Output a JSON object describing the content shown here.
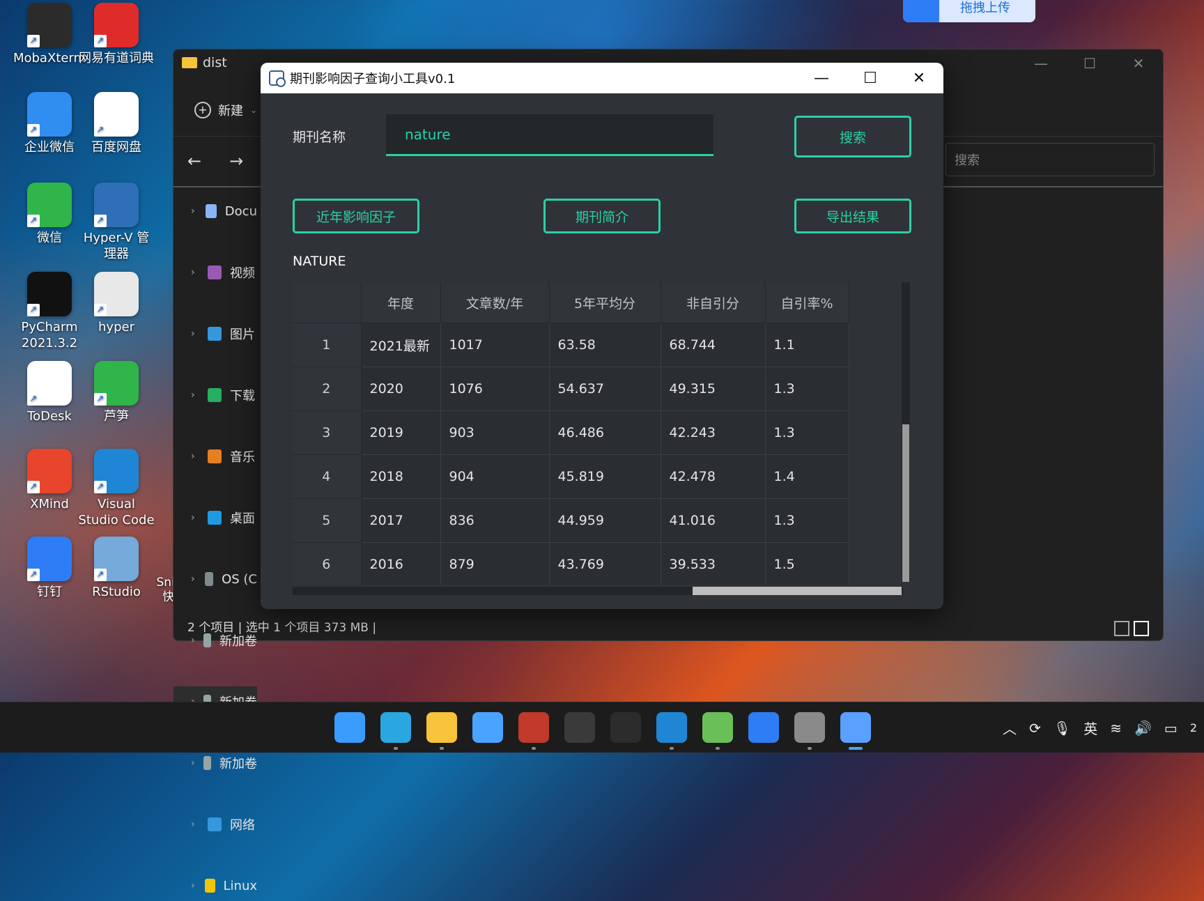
{
  "desktop": {
    "icons": [
      {
        "label": "MobaXterm",
        "color": "#2b2b2b"
      },
      {
        "label": "网易有道词典",
        "color": "#e02b2b"
      },
      {
        "label": "企业微信",
        "color": "#2f8ef0"
      },
      {
        "label": "百度网盘",
        "color": "#ffffff"
      },
      {
        "label": "微信",
        "color": "#2fb54a"
      },
      {
        "label": "Hyper-V 管理器",
        "color": "#2e6fb7"
      },
      {
        "label": "PyCharm 2021.3.2",
        "color": "#111111"
      },
      {
        "label": "hyper",
        "color": "#e8e8e8"
      },
      {
        "label": "ToDesk",
        "color": "#ffffff"
      },
      {
        "label": "芦笋",
        "color": "#2fb54a"
      },
      {
        "label": "XMind",
        "color": "#e8452c"
      },
      {
        "label": "Visual Studio Code",
        "color": "#1f86d6"
      },
      {
        "label": "钉钉",
        "color": "#2f7df6"
      },
      {
        "label": "RStudio",
        "color": "#75aadb"
      }
    ],
    "snipaste_label": "Snipaste - 快捷方式"
  },
  "upload_banner": {
    "label": "拖拽上传"
  },
  "explorer": {
    "title": "dist",
    "new_label": "新建",
    "search_placeholder": "搜索",
    "tree": [
      {
        "label": "Docu",
        "color": "#8ab4f8"
      },
      {
        "label": "视频",
        "color": "#9b59b6"
      },
      {
        "label": "图片",
        "color": "#3498db"
      },
      {
        "label": "下载",
        "color": "#27ae60"
      },
      {
        "label": "音乐",
        "color": "#e67e22"
      },
      {
        "label": "桌面",
        "color": "#1f9ae0"
      },
      {
        "label": "OS (C",
        "color": "#7f8c8d"
      },
      {
        "label": "新加卷",
        "color": "#95a5a6"
      },
      {
        "label": "新加卷",
        "color": "#95a5a6"
      },
      {
        "label": "新加卷",
        "color": "#95a5a6"
      },
      {
        "label": "网络",
        "color": "#3498db"
      },
      {
        "label": "Linux",
        "color": "#f1c40f"
      }
    ],
    "status": "2 个项目  |  选中 1 个项目  373 MB  |"
  },
  "app": {
    "title": "期刊影响因子查询小工具v0.1",
    "journal_label": "期刊名称",
    "search_value": "nature",
    "search_button": "搜索",
    "recent_if_button": "近年影响因子",
    "intro_button": "期刊简介",
    "export_button": "导出结果",
    "journal_name": "NATURE",
    "accent": "#2ad1a8",
    "table": {
      "headers": [
        "",
        "年度",
        "文章数/年",
        "5年平均分",
        "非自引分",
        "自引率%"
      ],
      "rows": [
        [
          "1",
          "2021最新",
          "1017",
          "63.58",
          "68.744",
          "1.1"
        ],
        [
          "2",
          "2020",
          "1076",
          "54.637",
          "49.315",
          "1.3"
        ],
        [
          "3",
          "2019",
          "903",
          "46.486",
          "42.243",
          "1.3"
        ],
        [
          "4",
          "2018",
          "904",
          "45.819",
          "42.478",
          "1.4"
        ],
        [
          "5",
          "2017",
          "836",
          "44.959",
          "41.016",
          "1.3"
        ],
        [
          "6",
          "2016",
          "879",
          "43.769",
          "39.533",
          "1.5"
        ]
      ]
    }
  },
  "taskbar": {
    "apps": [
      "start-icon",
      "edge-icon",
      "file-explorer-icon",
      "store-icon",
      "mcafee-icon",
      "terminal-icon",
      "cmd-icon",
      "vscode-icon",
      "notepad-icon",
      "dingtalk-icon",
      "settings-icon",
      "journal-tool-icon"
    ],
    "ime": "英",
    "clock_fragment": "2"
  }
}
